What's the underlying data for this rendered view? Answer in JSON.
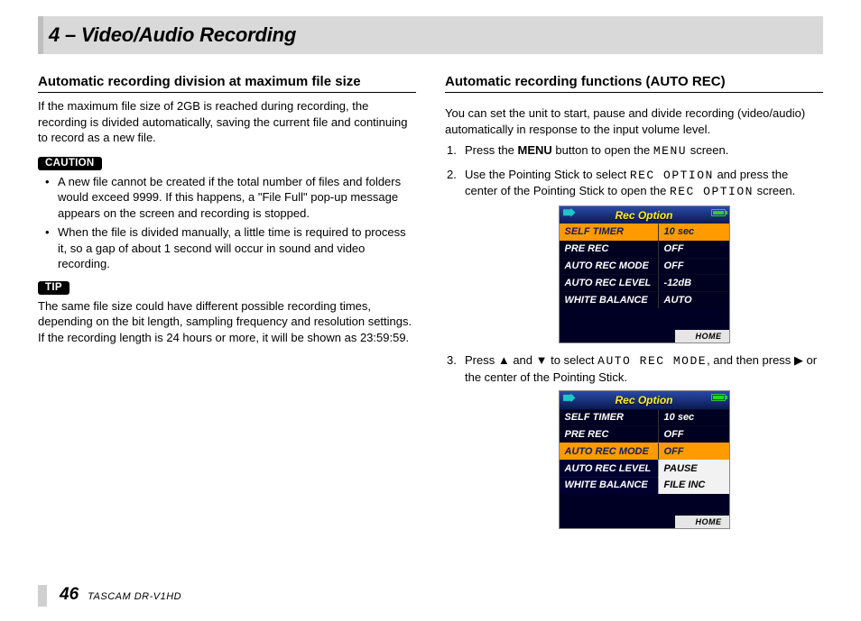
{
  "chapter": "4 – Video/Audio Recording",
  "left": {
    "section_title": "Automatic recording division at maximum file size",
    "intro": "If the maximum file size of 2GB is reached during recording, the recording is divided automatically, saving the current file and continuing to record as a new file.",
    "caution_label": "CAUTION",
    "caution_items": [
      "A new file cannot be created if the total number of files and folders would exceed 9999. If this happens, a \"File Full\" pop-up message appears on the screen and recording is stopped.",
      "When the file is divided manually, a little time is required to process it, so a gap of about 1 second will occur in sound and video recording."
    ],
    "tip_label": "TIP",
    "tip_text": "The same file size could have different possible recording times, depending on the bit length, sampling frequency and resolution settings. If the recording length is 24 hours or more, it will be shown as 23:59:59."
  },
  "right": {
    "section_title": "Automatic recording functions (AUTO REC)",
    "intro": "You can set the unit to start, pause and divide recording (video/audio) automatically in response to the input volume level.",
    "step1_a": "Press the ",
    "step1_bold": "MENU",
    "step1_b": " button to open the ",
    "step1_screen": "MENU",
    "step1_c": " screen.",
    "step2_a": "Use the Pointing Stick to select ",
    "step2_screen1": "REC OPTION",
    "step2_b": " and press the center of the Pointing Stick to open the ",
    "step2_screen2": "REC OPTION",
    "step2_c": " screen.",
    "lcd1": {
      "title": "Rec Option",
      "rows": [
        {
          "k": "SELF TIMER",
          "v": "10 sec",
          "hl": "row"
        },
        {
          "k": "PRE REC",
          "v": "OFF"
        },
        {
          "k": "AUTO REC MODE",
          "v": "OFF"
        },
        {
          "k": "AUTO REC LEVEL",
          "v": "-12dB"
        },
        {
          "k": "WHITE BALANCE",
          "v": "AUTO"
        }
      ],
      "home": "HOME"
    },
    "step3_a": "Press ",
    "step3_up": "▲",
    "step3_b": " and ",
    "step3_down": "▼",
    "step3_c": " to select ",
    "step3_screen": "AUTO REC MODE",
    "step3_d": ", and then press ",
    "step3_right": "▶",
    "step3_e": " or the center of the Pointing Stick.",
    "lcd2": {
      "title": "Rec Option",
      "rows": [
        {
          "k": "SELF TIMER",
          "v": "10 sec"
        },
        {
          "k": "PRE REC",
          "v": "OFF"
        },
        {
          "k": "AUTO REC MODE",
          "v": "OFF",
          "hl": "split"
        },
        {
          "k": "AUTO REC LEVEL",
          "v": "PAUSE",
          "sub": true
        },
        {
          "k": "WHITE BALANCE",
          "v": "FILE INC",
          "sub": true
        }
      ],
      "home": "HOME"
    }
  },
  "footer": {
    "page": "46",
    "model": "TASCAM  DR-V1HD"
  }
}
